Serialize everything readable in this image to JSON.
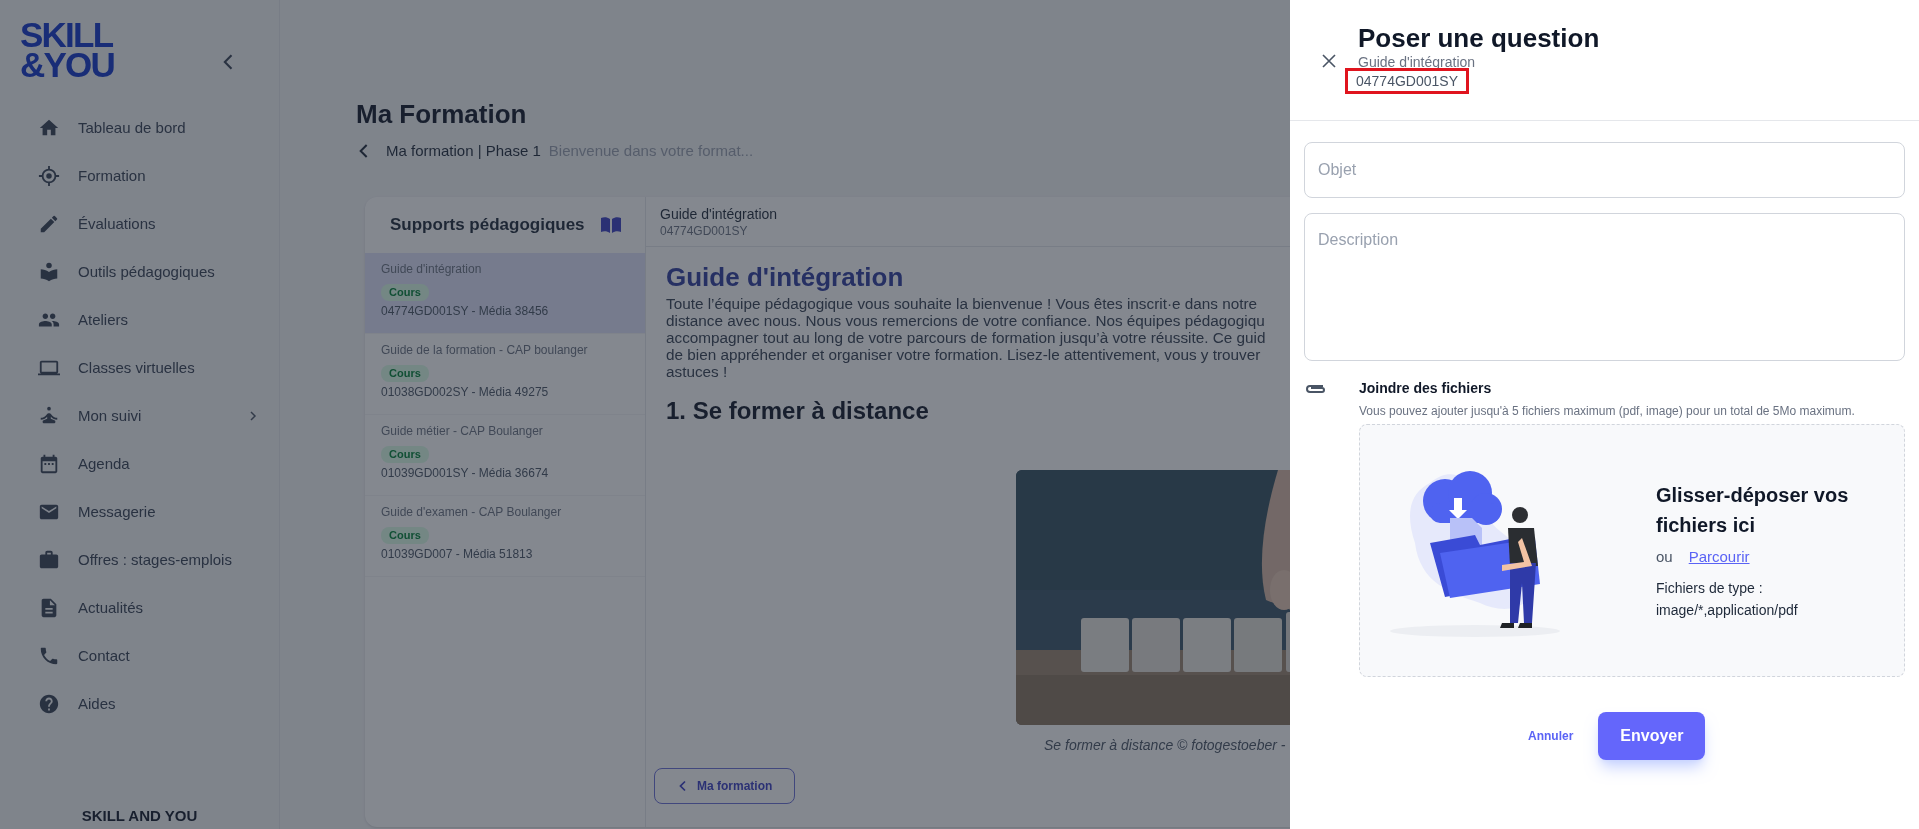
{
  "sidebar": {
    "logo": "SKILL\n&YOU",
    "items": [
      {
        "label": "Tableau de bord",
        "submenu": false
      },
      {
        "label": "Formation",
        "submenu": false
      },
      {
        "label": "Évaluations",
        "submenu": false
      },
      {
        "label": "Outils pédagogiques",
        "submenu": false
      },
      {
        "label": "Ateliers",
        "submenu": false
      },
      {
        "label": "Classes virtuelles",
        "submenu": false
      },
      {
        "label": "Mon suivi",
        "submenu": true
      },
      {
        "label": "Agenda",
        "submenu": false
      },
      {
        "label": "Messagerie",
        "submenu": false
      },
      {
        "label": "Offres : stages-emplois",
        "submenu": false
      },
      {
        "label": "Actualités",
        "submenu": false
      },
      {
        "label": "Contact",
        "submenu": false
      },
      {
        "label": "Aides",
        "submenu": false
      }
    ],
    "footer": "SKILL AND YOU"
  },
  "page": {
    "title": "Ma Formation",
    "breadcrumb": "Ma formation | Phase 1",
    "breadcrumb_hint": "Bienvenue dans votre format..."
  },
  "supports": {
    "title": "Supports pédagogiques",
    "items": [
      {
        "title": "Guide d'intégration",
        "badge": "Cours",
        "reference": "04774GD001SY - Média 38456",
        "selected": true
      },
      {
        "title": "Guide de la formation - CAP boulanger",
        "badge": "Cours",
        "reference": "01038GD002SY - Média 49275",
        "selected": false
      },
      {
        "title": "Guide métier - CAP Boulanger",
        "badge": "Cours",
        "reference": "01039GD001SY - Média 36674",
        "selected": false
      },
      {
        "title": "Guide d'examen - CAP Boulanger",
        "badge": "Cours",
        "reference": "01039GD007 - Média 51813",
        "selected": false
      }
    ]
  },
  "viewer": {
    "title": "Guide d'intégration",
    "reference": "04774GD001SY",
    "heading": "Guide d'intégration",
    "paragraph_lines": [
      "Toute l’équipe pédagogique vous souhaite la bienvenue ! Vous êtes inscrit·e dans notre",
      "distance avec nous. Nous vous remercions de votre confiance. Nos équipes pédagogiqu",
      "accompagner tout au long de votre parcours de formation jusqu’à votre réussite. Ce guid",
      "de bien appréhender et organiser votre formation. Lisez-le attentivement, vous y trouver",
      "astuces !"
    ],
    "section_heading": "1. Se former à distance",
    "caption": "Se former à distance © fotogestoeber -",
    "back_button": "Ma formation"
  },
  "drawer": {
    "title": "Poser une question",
    "subtitle": "Guide d'intégration",
    "reference": "04774GD001SY",
    "reference_highlighted": true,
    "subject": {
      "placeholder": "Objet"
    },
    "description": {
      "placeholder": "Description"
    },
    "attach_title": "Joindre des fichiers",
    "attach_hint": "Vous pouvez ajouter jusqu'à 5 fichiers maximum (pdf, image) pour un total de 5Mo maximum.",
    "dropzone": {
      "title": "Glisser-déposer vos fichiers ici",
      "or": "ou",
      "browse": "Parcourir",
      "types_label": "Fichiers de type :",
      "types": "image/*,application/pdf"
    },
    "cancel": "Annuler",
    "submit": "Envoyer"
  }
}
